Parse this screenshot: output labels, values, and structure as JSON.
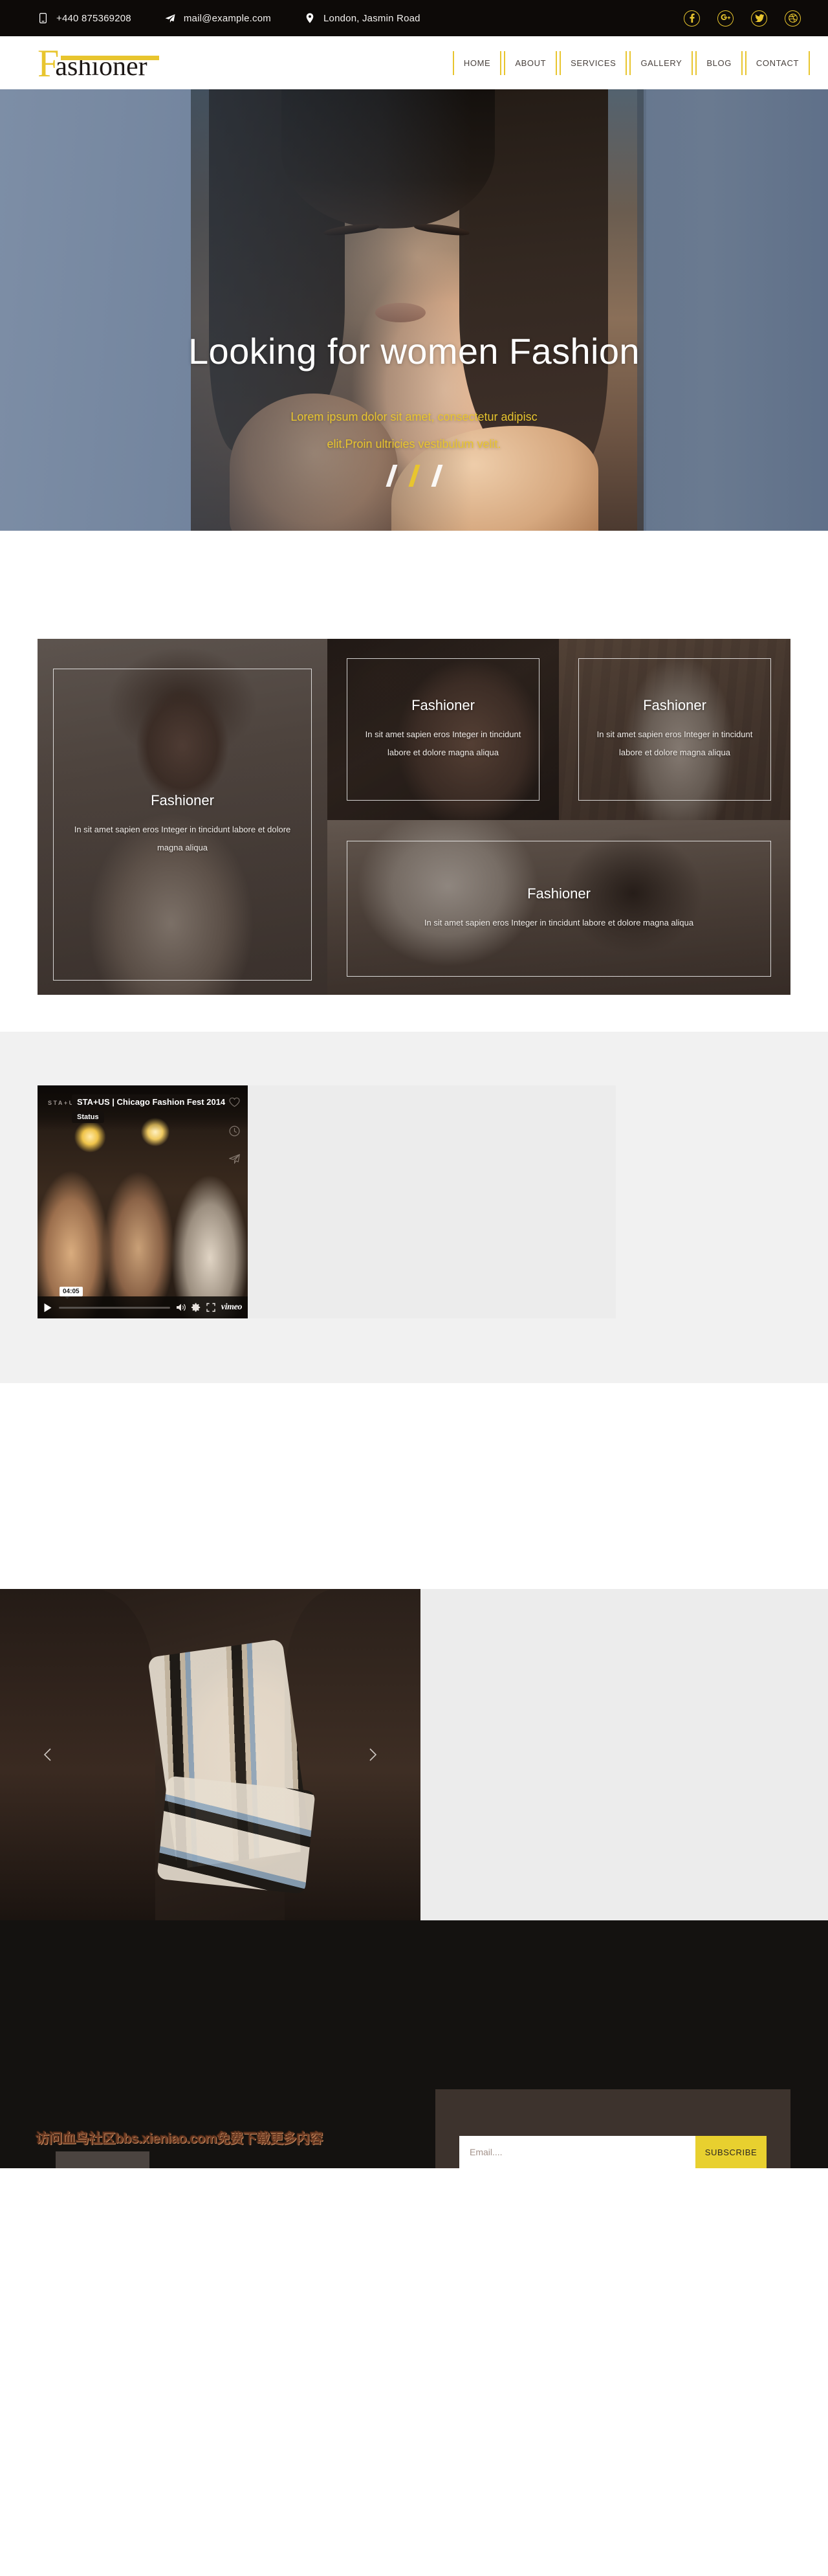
{
  "topbar": {
    "contacts": [
      {
        "icon": "phone-icon",
        "text": "+440 875369208"
      },
      {
        "icon": "paper-plane-icon",
        "text": "mail@example.com"
      },
      {
        "icon": "map-pin-icon",
        "text": "London, Jasmin Road"
      }
    ],
    "social": [
      {
        "name": "facebook-icon",
        "glyph": "f"
      },
      {
        "name": "google-plus-icon",
        "glyph": "g+"
      },
      {
        "name": "twitter-icon",
        "glyph": "t"
      },
      {
        "name": "dribbble-icon",
        "glyph": "d"
      }
    ],
    "accent_color": "#e8c52e",
    "background_color": "#0d0a08"
  },
  "header": {
    "logo_first": "F",
    "logo_rest": "ashioner",
    "nav": [
      {
        "label": "HOME"
      },
      {
        "label": "ABOUT"
      },
      {
        "label": "SERVICES"
      },
      {
        "label": "GALLERY"
      },
      {
        "label": "BLOG"
      },
      {
        "label": "CONTACT"
      }
    ]
  },
  "hero": {
    "title": "Looking for women Fashion",
    "subtitle_line1": "Lorem ipsum dolor sit amet, consectetur adipisc",
    "subtitle_line2": "elit.Proin ultricies vestibulum velit.",
    "slides": [
      {
        "active": false
      },
      {
        "active": true
      },
      {
        "active": false
      }
    ],
    "title_color": "#ffffff",
    "subtitle_color": "#e8c52e"
  },
  "gallery": {
    "tiles": [
      {
        "id": "tile-a",
        "title": "Fashioner",
        "text": "In sit amet sapien eros Integer in tincidunt labore et dolore magna aliqua"
      },
      {
        "id": "tile-b",
        "title": "Fashioner",
        "text": "In sit amet sapien eros Integer in tincidunt labore et dolore magna aliqua"
      },
      {
        "id": "tile-c",
        "title": "Fashioner",
        "text": "In sit amet sapien eros Integer in tincidunt labore et dolore magna aliqua"
      },
      {
        "id": "tile-d",
        "title": "Fashioner",
        "text": "In sit amet sapien eros Integer in tincidunt labore et dolore magna aliqua"
      }
    ]
  },
  "video": {
    "brand": "STA+US",
    "title": "STA+US | Chicago Fashion Fest 2014",
    "channel": "Status",
    "time_tooltip": "04:05",
    "provider": "vimeo",
    "side_actions": [
      {
        "name": "like-heart-icon"
      },
      {
        "name": "watch-later-clock-icon"
      },
      {
        "name": "share-icon"
      }
    ],
    "controls": [
      {
        "name": "play-button"
      },
      {
        "name": "progress-bar"
      },
      {
        "name": "volume-icon"
      },
      {
        "name": "settings-gear-icon"
      },
      {
        "name": "fullscreen-icon"
      }
    ]
  },
  "carousel": {
    "prev_label": "‹",
    "next_label": "›"
  },
  "footer": {
    "watermark": "访问血鸟社区bbs.xieniao.com免费下载更多内容",
    "subscribe": {
      "placeholder": "Email....",
      "button_label": "SUBSCRIBE",
      "button_color": "#e8d02f"
    }
  }
}
